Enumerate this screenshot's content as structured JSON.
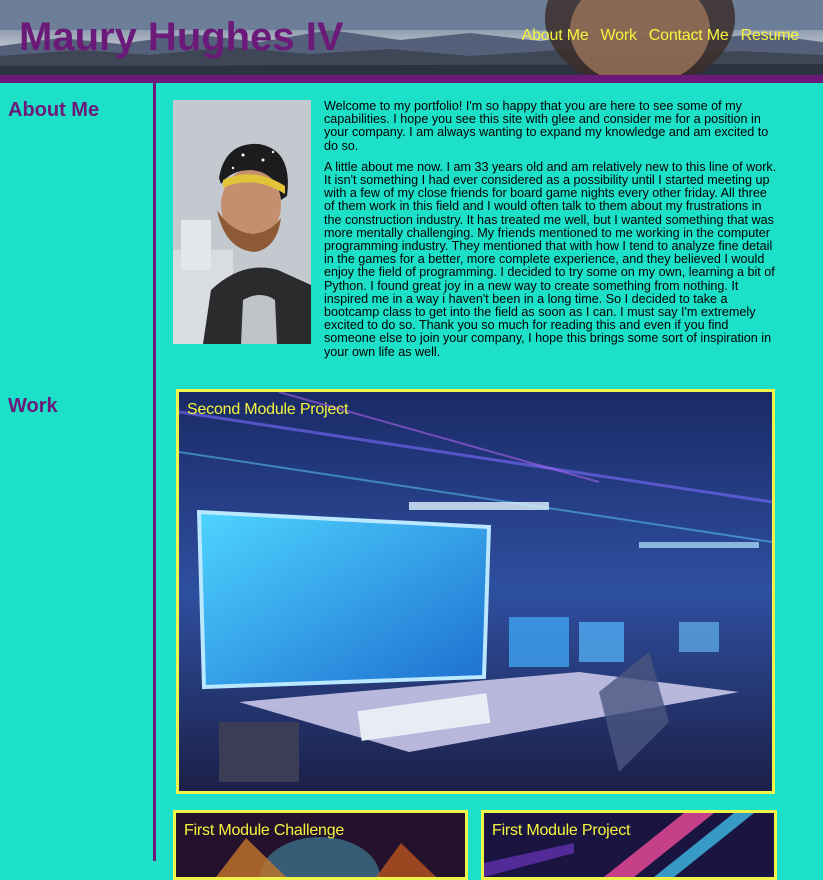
{
  "header": {
    "title": "Maury Hughes IV",
    "nav": [
      "About Me",
      "Work",
      "Contact Me",
      "Resume"
    ]
  },
  "sidebar": {
    "about_heading": "About Me",
    "work_heading": "Work"
  },
  "about": {
    "paragraphs": [
      "Welcome to my portfolio! I'm so happy that you are here to see some of my capabilities. I hope you see this site with glee and consider me for a position in your company. I am always wanting to expand my knowledge and am excited to do so.",
      "A little about me now. I am 33 years old and am relatively new to this line of work. It isn't something I had ever considered as a possibility until I started meeting up with a few of my close friends for board game nights every other friday. All three of them work in this field and I would often talk to them about my frustrations in the construction industry. It has treated me well, but I wanted something that was more mentally challenging. My friends mentioned to me working in the computer programming industry. They mentioned that with how I tend to analyze fine detail in the games for a better, more complete experience, and they believed I would enjoy the field of programming. I decided to try some on my own, learning a bit of Python. I found great joy in a new way to create something from nothing. It inspired me in a way i haven't been in a long time. So I decided to take a bootcamp class to get into the field as soon as I can. I must say I'm extremely excited to do so. Thank you so much for reading this and even if you find someone else to join your company, I hope this brings some sort of inspiration in your own life as well."
    ]
  },
  "work": {
    "cards": [
      {
        "title": "Second Module Project"
      },
      {
        "title": "First Module Challenge"
      },
      {
        "title": "First Module Project"
      }
    ]
  },
  "colors": {
    "background": "#1de0c8",
    "accent_purple": "#6b1a7a",
    "nav_yellow": "#f6f53e",
    "card_border": "#f0f54a"
  }
}
